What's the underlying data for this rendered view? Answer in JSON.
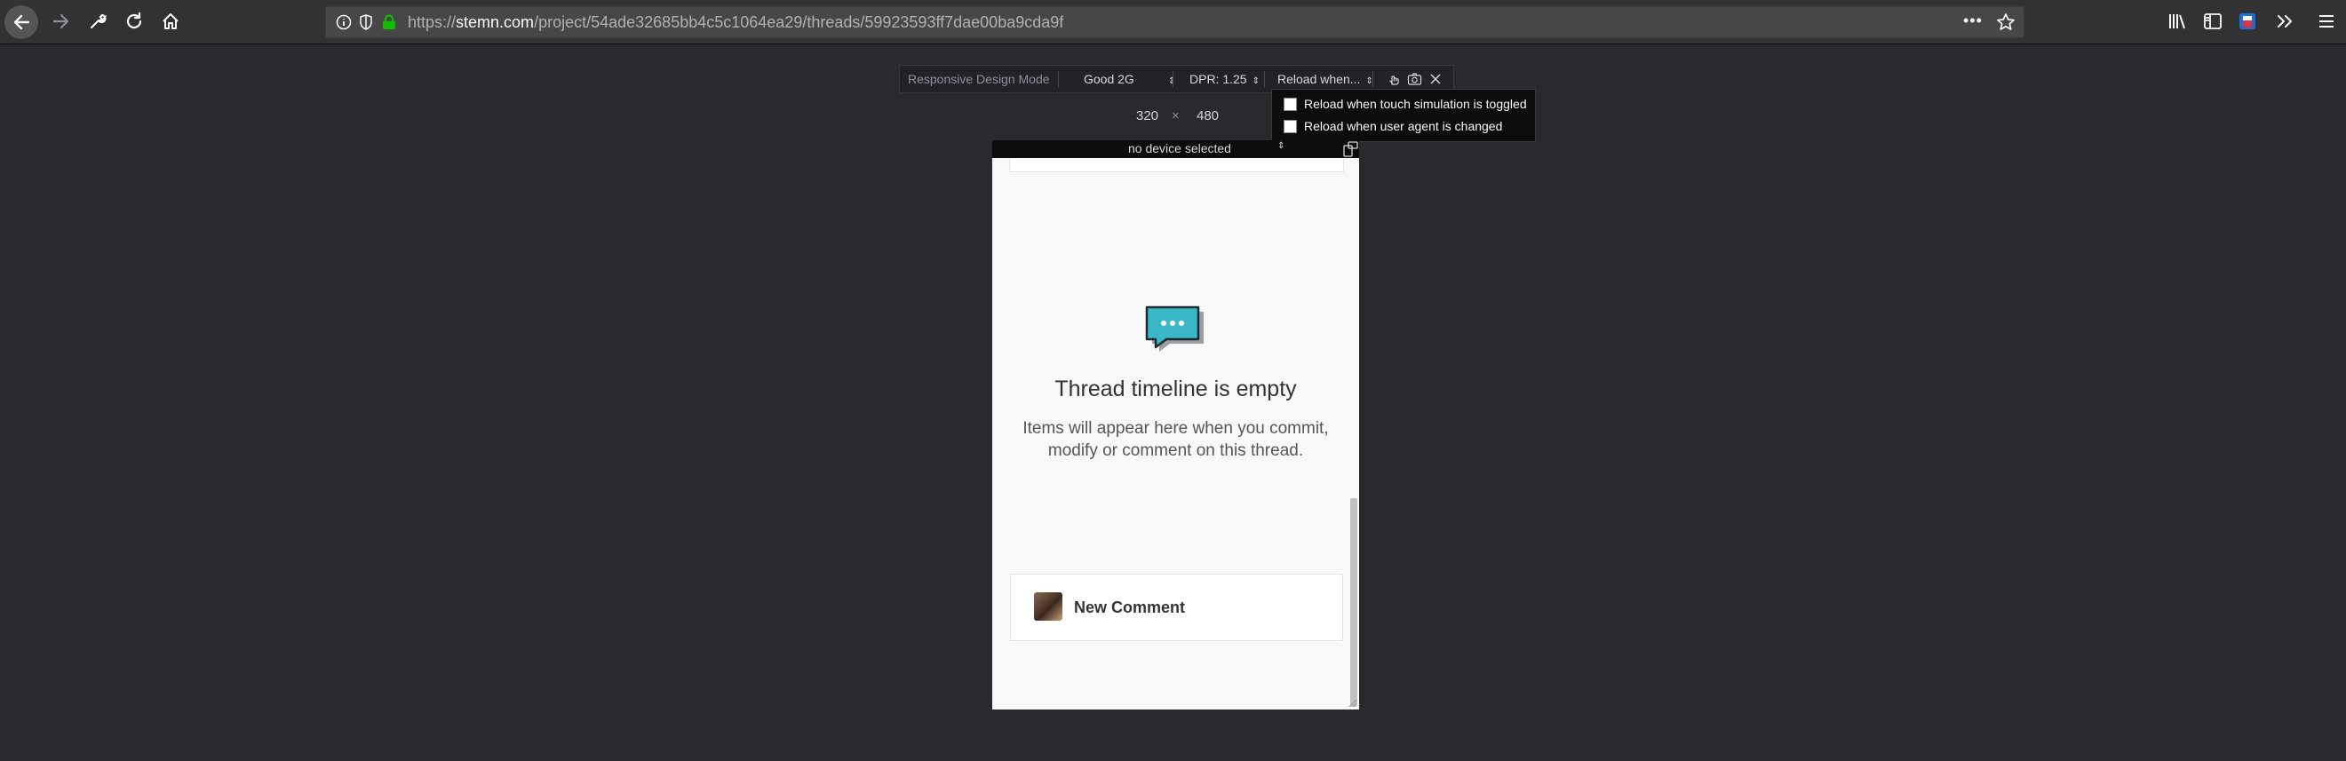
{
  "browser": {
    "url_prefix": "https://",
    "url_domain": "stemn.com",
    "url_path": "/project/54ade32685bb4c5c1064ea29/threads/59923593ff7dae00ba9cda9f",
    "more_label": "•••"
  },
  "rdm": {
    "title": "Responsive Design Mode",
    "network": "Good 2G",
    "dpr": "DPR: 1.25",
    "reload": "Reload when...",
    "width": "320",
    "times": "×",
    "height": "480",
    "device": "no device selected",
    "menu": [
      "Reload when touch simulation is toggled",
      "Reload when user agent is changed"
    ]
  },
  "page": {
    "empty_title": "Thread timeline is empty",
    "empty_desc_line1": "Items will appear here when you commit,",
    "empty_desc_line2": "modify or comment on this thread.",
    "new_comment": "New Comment"
  },
  "colors": {
    "accent_teal": "#3ab8c8",
    "chrome_bg": "#2a2a2e",
    "secure_lock": "#12bc00"
  }
}
